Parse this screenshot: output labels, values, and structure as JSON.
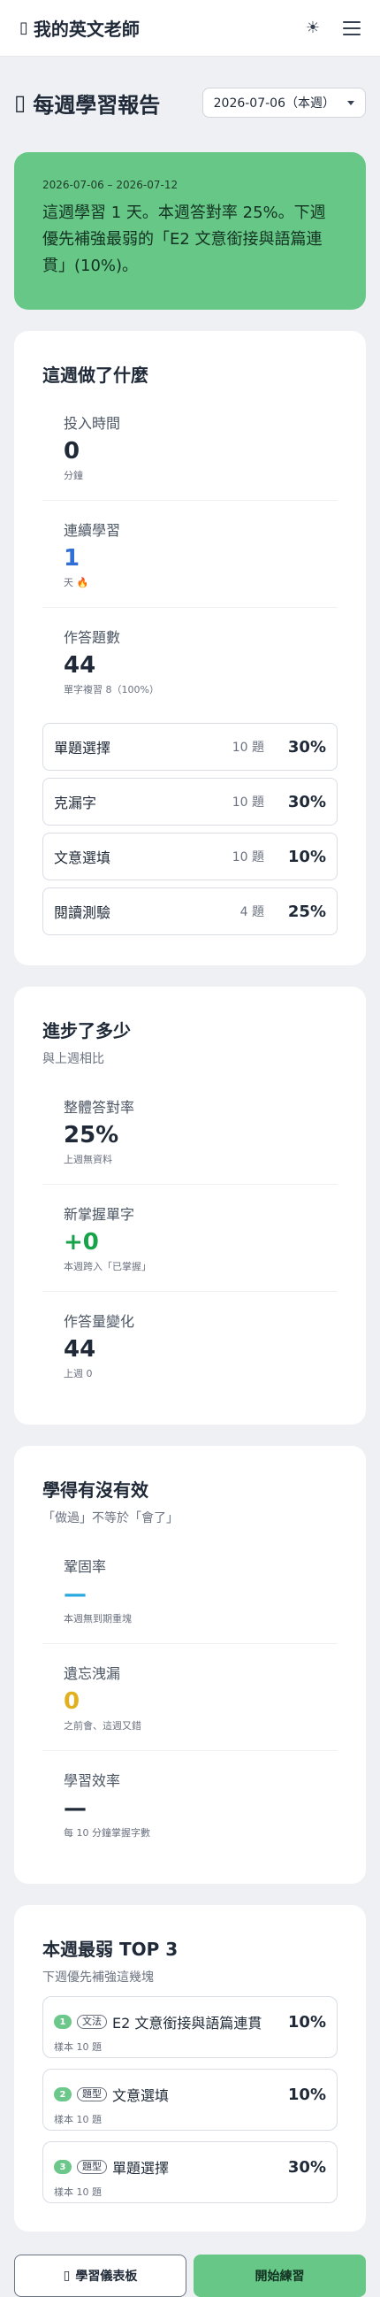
{
  "app": {
    "title": "我的英文老師",
    "theme_icon": "☀"
  },
  "header": {
    "title": "每週學習報告",
    "week_select": "2026-07-06（本週）"
  },
  "hero": {
    "range": "2026-07-06 – 2026-07-12",
    "summary": "這週學習 1 天。本週答對率 25%。下週優先補強最弱的「E2 文意銜接與語篇連貫」(10%)。"
  },
  "activity": {
    "title": "這週做了什麼",
    "stats": [
      {
        "label": "投入時間",
        "value": "0",
        "note": "分鐘"
      },
      {
        "label": "連續學習",
        "value": "1",
        "note": "天 🔥"
      },
      {
        "label": "作答題數",
        "value": "44",
        "note": "單字複習 8（100%）"
      }
    ],
    "types": [
      {
        "name": "單題選擇",
        "count": "10 題",
        "pct": "30%"
      },
      {
        "name": "克漏字",
        "count": "10 題",
        "pct": "30%"
      },
      {
        "name": "文意選填",
        "count": "10 題",
        "pct": "10%"
      },
      {
        "name": "閱讀測驗",
        "count": "4 題",
        "pct": "25%"
      }
    ]
  },
  "progress": {
    "title": "進步了多少",
    "subtitle": "與上週相比",
    "stats": [
      {
        "label": "整體答對率",
        "value": "25%",
        "note": "上週無資料"
      },
      {
        "label": "新掌握單字",
        "value": "+0",
        "note": "本週跨入「已掌握」"
      },
      {
        "label": "作答量變化",
        "value": "44",
        "note": "上週 0"
      }
    ]
  },
  "effect": {
    "title": "學得有沒有效",
    "subtitle": "「做過」不等於「會了」",
    "stats": [
      {
        "label": "鞏固率",
        "value": "—",
        "note": "本週無到期重塊"
      },
      {
        "label": "遺忘洩漏",
        "value": "0",
        "note": "之前會、這週又錯"
      },
      {
        "label": "學習效率",
        "value": "—",
        "note": "每 10 分鐘掌握字數"
      }
    ]
  },
  "weakest": {
    "title": "本週最弱 TOP 3",
    "subtitle": "下週優先補強這幾塊",
    "items": [
      {
        "rank": "1",
        "tag": "文法",
        "name": "E2 文意銜接與語篇連貫",
        "pct": "10%",
        "sample": "樣本 10 題"
      },
      {
        "rank": "2",
        "tag": "題型",
        "name": "文意選填",
        "pct": "10%",
        "sample": "樣本 10 題"
      },
      {
        "rank": "3",
        "tag": "題型",
        "name": "單題選擇",
        "pct": "30%",
        "sample": "樣本 10 題"
      }
    ]
  },
  "actions": {
    "dashboard": "學習儀表板",
    "practice": "開始練習"
  },
  "colors": {
    "accent_green": "#67c787",
    "blue": "#2f6fd6",
    "green": "#16a34a",
    "sky": "#2aa8e0",
    "amber": "#e0b020"
  }
}
